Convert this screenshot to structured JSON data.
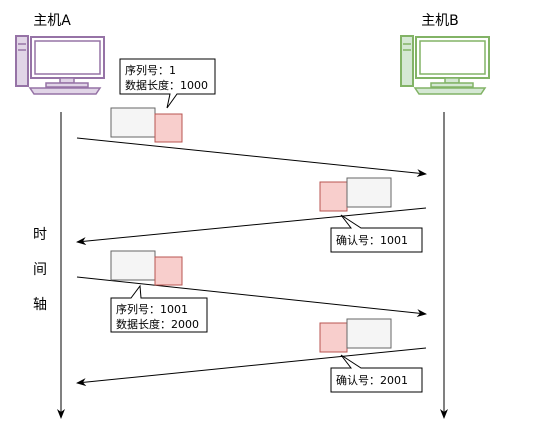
{
  "hosts": {
    "a": {
      "label": "主机A",
      "color": "#9673a6",
      "fill": "#e1d5e7"
    },
    "b": {
      "label": "主机B",
      "color": "#82b366",
      "fill": "#d5e8d4"
    }
  },
  "time_axis": {
    "chars": [
      "时",
      "间",
      "轴"
    ]
  },
  "exchanges": [
    {
      "direction": "A-to-B",
      "callout_lines": [
        "序列号：1",
        "数据长度：1000"
      ]
    },
    {
      "direction": "B-to-A",
      "callout_lines": [
        "确认号：1001"
      ]
    },
    {
      "direction": "A-to-B",
      "callout_lines": [
        "序列号：1001",
        "数据长度：2000"
      ]
    },
    {
      "direction": "B-to-A",
      "callout_lines": [
        "确认号：2001"
      ]
    }
  ],
  "colors": {
    "segment_fill": "#f5f5f5",
    "segment_highlight": "#f8cecc",
    "segment_highlight_stroke": "#b85450",
    "line": "#000000"
  }
}
